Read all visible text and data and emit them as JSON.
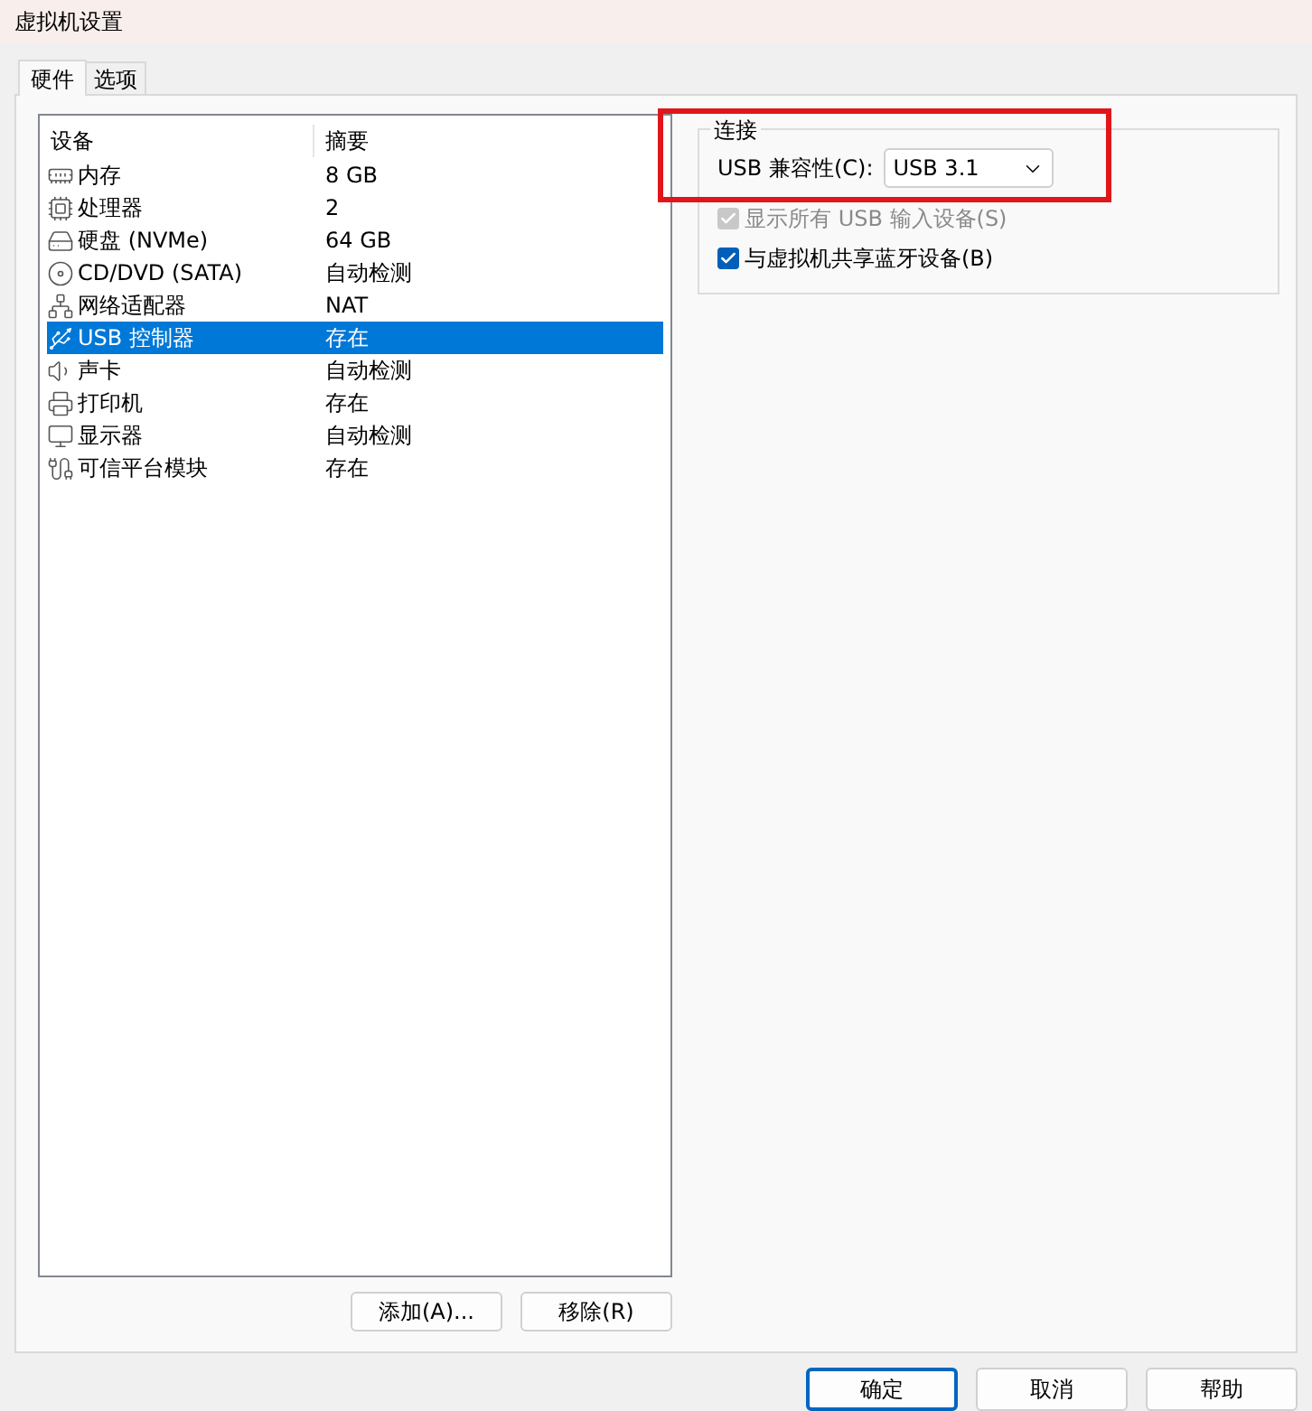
{
  "window": {
    "title": "虚拟机设置"
  },
  "tabs": [
    {
      "label": "硬件",
      "selected": true
    },
    {
      "label": "选项",
      "selected": false
    }
  ],
  "device_table": {
    "columns": [
      "设备",
      "摘要"
    ],
    "rows": [
      {
        "kind": "memory",
        "device": "内存",
        "summary": "8 GB",
        "selected": false
      },
      {
        "kind": "cpu",
        "device": "处理器",
        "summary": "2",
        "selected": false
      },
      {
        "kind": "disk",
        "device": "硬盘 (NVMe)",
        "summary": "64 GB",
        "selected": false
      },
      {
        "kind": "disc",
        "device": "CD/DVD (SATA)",
        "summary": "自动检测",
        "selected": false
      },
      {
        "kind": "network",
        "device": "网络适配器",
        "summary": "NAT",
        "selected": false
      },
      {
        "kind": "usb",
        "device": "USB 控制器",
        "summary": "存在",
        "selected": true
      },
      {
        "kind": "sound",
        "device": "声卡",
        "summary": "自动检测",
        "selected": false
      },
      {
        "kind": "printer",
        "device": "打印机",
        "summary": "存在",
        "selected": false
      },
      {
        "kind": "display",
        "device": "显示器",
        "summary": "自动检测",
        "selected": false
      },
      {
        "kind": "tpm",
        "device": "可信平台模块",
        "summary": "存在",
        "selected": false
      }
    ]
  },
  "list_buttons": [
    "添加(A)...",
    "移除(R)"
  ],
  "connection": {
    "title": "连接",
    "compat_label": "USB 兼容性(C):",
    "compat_value": "USB 3.1",
    "options": [
      {
        "label": "显示所有 USB 输入设备(S)",
        "checked": true,
        "disabled": true
      },
      {
        "label": "与虚拟机共享蓝牙设备(B)",
        "checked": true,
        "disabled": false
      }
    ]
  },
  "dialog_buttons": [
    {
      "label": "确定",
      "default": true
    },
    {
      "label": "取消",
      "default": false
    },
    {
      "label": "帮助",
      "default": false
    }
  ]
}
